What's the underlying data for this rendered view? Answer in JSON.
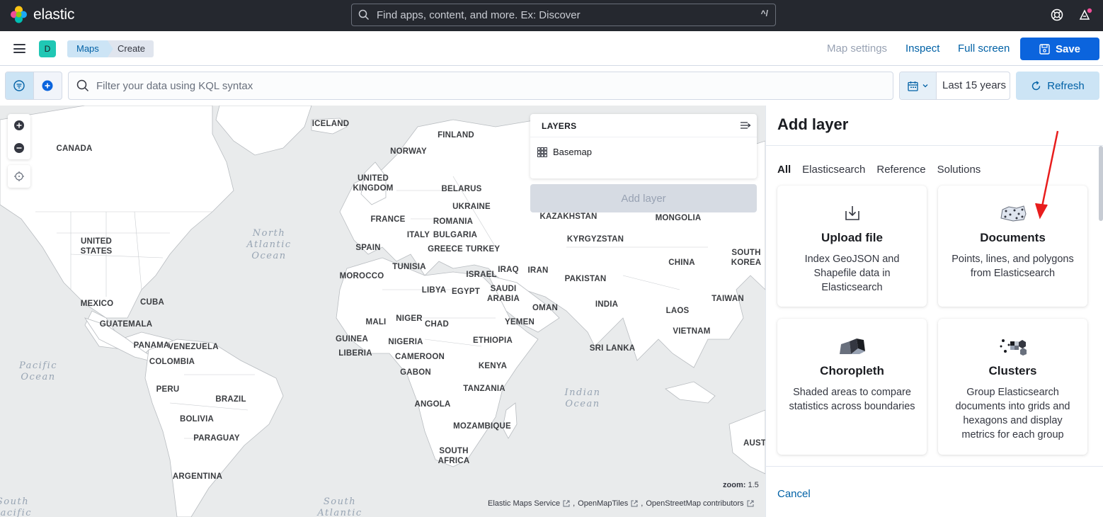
{
  "topbar": {
    "logo_text": "elastic",
    "search_placeholder": "Find apps, content, and more. Ex: Discover",
    "search_shortcut": "^/"
  },
  "subbar": {
    "avatar_letter": "D",
    "breadcrumbs": [
      "Maps",
      "Create"
    ],
    "links": {
      "map_settings": "Map settings",
      "inspect": "Inspect",
      "full_screen": "Full screen"
    },
    "save_label": "Save"
  },
  "querybar": {
    "kql_placeholder": "Filter your data using KQL syntax",
    "time_range": "Last 15 years",
    "refresh_label": "Refresh"
  },
  "map": {
    "labels": [
      {
        "id": "iceland",
        "text": "ICELAND"
      },
      {
        "id": "finland",
        "text": "FINLAND"
      },
      {
        "id": "canada",
        "text": "CANADA"
      },
      {
        "id": "norway",
        "text": "NORWAY"
      },
      {
        "id": "uk",
        "text": "UNITED\nKINGDOM"
      },
      {
        "id": "belarus",
        "text": "BELARUS"
      },
      {
        "id": "ukraine",
        "text": "UKRAINE"
      },
      {
        "id": "france",
        "text": "FRANCE"
      },
      {
        "id": "romania",
        "text": "ROMANIA"
      },
      {
        "id": "kazakhstan",
        "text": "KAZAKHSTAN"
      },
      {
        "id": "mongolia",
        "text": "MONGOLIA"
      },
      {
        "id": "us",
        "text": "UNITED\nSTATES"
      },
      {
        "id": "italy",
        "text": "ITALY"
      },
      {
        "id": "bulgaria",
        "text": "BULGARIA"
      },
      {
        "id": "kyrgyzstan",
        "text": "KYRGYZSTAN"
      },
      {
        "id": "spain",
        "text": "SPAIN"
      },
      {
        "id": "greece",
        "text": "GREECE"
      },
      {
        "id": "turkey",
        "text": "TURKEY"
      },
      {
        "id": "southkorea",
        "text": "SOUTH\nKOREA"
      },
      {
        "id": "tunisia",
        "text": "TUNISIA"
      },
      {
        "id": "china",
        "text": "CHINA"
      },
      {
        "id": "morocco",
        "text": "MOROCCO"
      },
      {
        "id": "israel",
        "text": "ISRAEL"
      },
      {
        "id": "iraq",
        "text": "IRAQ"
      },
      {
        "id": "iran",
        "text": "IRAN"
      },
      {
        "id": "pakistan",
        "text": "PAKISTAN"
      },
      {
        "id": "libya",
        "text": "LIBYA"
      },
      {
        "id": "egypt",
        "text": "EGYPT"
      },
      {
        "id": "saudi",
        "text": "SAUDI\nARABIA"
      },
      {
        "id": "taiwan",
        "text": "TAIWAN"
      },
      {
        "id": "mexico",
        "text": "MEXICO"
      },
      {
        "id": "cuba",
        "text": "CUBA"
      },
      {
        "id": "india",
        "text": "INDIA"
      },
      {
        "id": "oman",
        "text": "OMAN"
      },
      {
        "id": "laos",
        "text": "LAOS"
      },
      {
        "id": "guatemala",
        "text": "GUATEMALA"
      },
      {
        "id": "mali",
        "text": "MALI"
      },
      {
        "id": "niger",
        "text": "NIGER"
      },
      {
        "id": "chad",
        "text": "CHAD"
      },
      {
        "id": "yemen",
        "text": "YEMEN"
      },
      {
        "id": "vietnam",
        "text": "VIETNAM"
      },
      {
        "id": "guinea",
        "text": "GUINEA"
      },
      {
        "id": "nigeria",
        "text": "NIGERIA"
      },
      {
        "id": "ethiopia",
        "text": "ETHIOPIA"
      },
      {
        "id": "panama",
        "text": "PANAMA"
      },
      {
        "id": "venezuela",
        "text": "VENEZUELA"
      },
      {
        "id": "liberia",
        "text": "LIBERIA"
      },
      {
        "id": "srilanka",
        "text": "SRI LANKA"
      },
      {
        "id": "cameroon",
        "text": "CAMEROON"
      },
      {
        "id": "colombia",
        "text": "COLOMBIA"
      },
      {
        "id": "gabon",
        "text": "GABON"
      },
      {
        "id": "kenya",
        "text": "KENYA"
      },
      {
        "id": "peru",
        "text": "PERU"
      },
      {
        "id": "brazil",
        "text": "BRAZIL"
      },
      {
        "id": "tanzania",
        "text": "TANZANIA"
      },
      {
        "id": "angola",
        "text": "ANGOLA"
      },
      {
        "id": "bolivia",
        "text": "BOLIVIA"
      },
      {
        "id": "mozambique",
        "text": "MOZAMBIQUE"
      },
      {
        "id": "paraguay",
        "text": "PARAGUAY"
      },
      {
        "id": "southafrica",
        "text": "SOUTH\nAFRICA"
      },
      {
        "id": "aust",
        "text": "AUST"
      },
      {
        "id": "argentina",
        "text": "ARGENTINA"
      }
    ],
    "oceans": [
      {
        "id": "north-atlantic",
        "text": "North\nAtlantic\nOcean"
      },
      {
        "id": "pacific",
        "text": "Pacific\nOcean"
      },
      {
        "id": "indian",
        "text": "Indian\nOcean"
      },
      {
        "id": "south-pacific",
        "text": "South\nPacific"
      },
      {
        "id": "south-atlantic",
        "text": "South\nAtlantic"
      }
    ],
    "layers_title": "LAYERS",
    "layers": [
      "Basemap"
    ],
    "add_layer_label": "Add layer",
    "zoom_label": "zoom:",
    "zoom_value": "1.5",
    "attribution": [
      "Elastic Maps Service",
      "OpenMapTiles",
      "OpenStreetMap contributors"
    ]
  },
  "flyout": {
    "title": "Add layer",
    "tabs": [
      "All",
      "Elasticsearch",
      "Reference",
      "Solutions"
    ],
    "cards": [
      {
        "title": "Upload file",
        "desc": "Index GeoJSON and Shapefile data in Elasticsearch",
        "icon": "upload-icon"
      },
      {
        "title": "Documents",
        "desc": "Points, lines, and polygons from Elasticsearch",
        "icon": "documents-icon"
      },
      {
        "title": "Choropleth",
        "desc": "Shaded areas to compare statistics across boundaries",
        "icon": "choropleth-icon"
      },
      {
        "title": "Clusters",
        "desc": "Group Elasticsearch documents into grids and hexagons and display metrics for each group",
        "icon": "clusters-icon"
      }
    ],
    "cancel_label": "Cancel"
  },
  "annotation_color": "#e81d1d"
}
